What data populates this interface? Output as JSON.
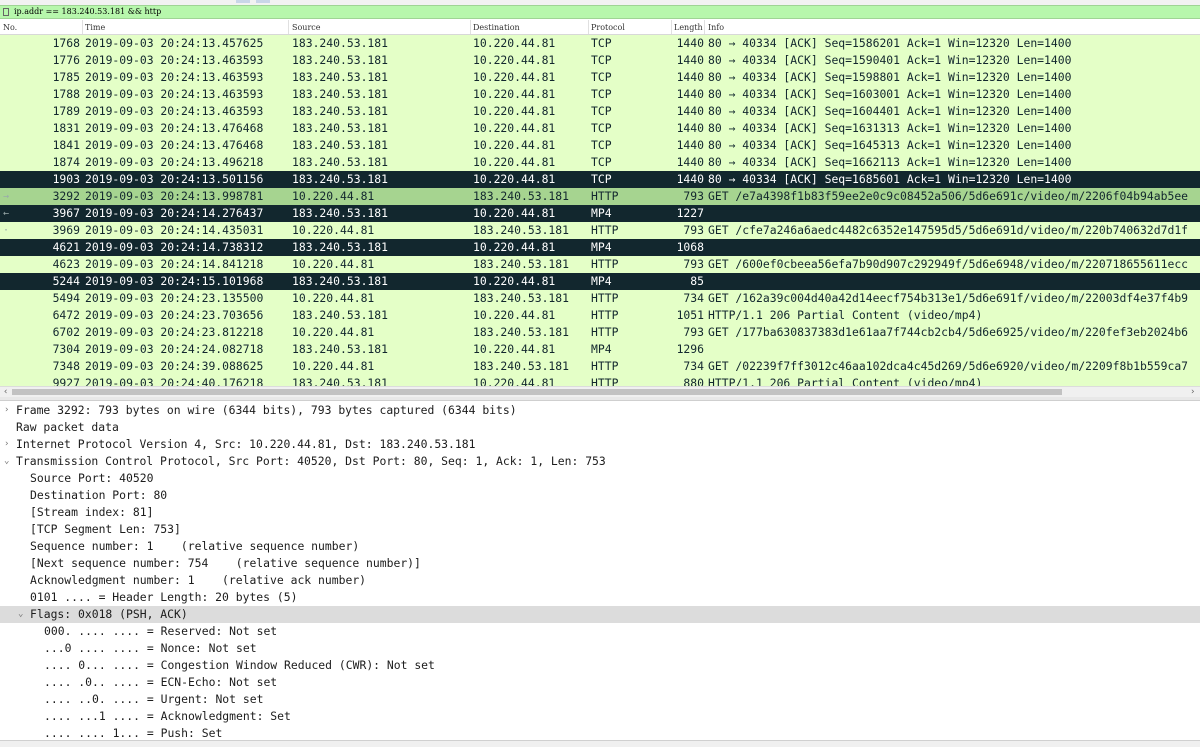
{
  "filter": {
    "text": "ip.addr == 183.240.53.181 && http"
  },
  "columns": {
    "no": "No.",
    "time": "Time",
    "source": "Source",
    "destination": "Destination",
    "protocol": "Protocol",
    "length": "Length",
    "info": "Info"
  },
  "packets": [
    {
      "no": "1768",
      "time": "2019-09-03 20:24:13.457625",
      "src": "183.240.53.181",
      "dst": "10.220.44.81",
      "proto": "TCP",
      "len": "1440",
      "info": "80 → 40334 [ACK] Seq=1586201 Ack=1 Win=12320 Len=1400",
      "style": "green",
      "mark": ""
    },
    {
      "no": "1776",
      "time": "2019-09-03 20:24:13.463593",
      "src": "183.240.53.181",
      "dst": "10.220.44.81",
      "proto": "TCP",
      "len": "1440",
      "info": "80 → 40334 [ACK] Seq=1590401 Ack=1 Win=12320 Len=1400",
      "style": "green",
      "mark": ""
    },
    {
      "no": "1785",
      "time": "2019-09-03 20:24:13.463593",
      "src": "183.240.53.181",
      "dst": "10.220.44.81",
      "proto": "TCP",
      "len": "1440",
      "info": "80 → 40334 [ACK] Seq=1598801 Ack=1 Win=12320 Len=1400",
      "style": "green",
      "mark": ""
    },
    {
      "no": "1788",
      "time": "2019-09-03 20:24:13.463593",
      "src": "183.240.53.181",
      "dst": "10.220.44.81",
      "proto": "TCP",
      "len": "1440",
      "info": "80 → 40334 [ACK] Seq=1603001 Ack=1 Win=12320 Len=1400",
      "style": "green",
      "mark": ""
    },
    {
      "no": "1789",
      "time": "2019-09-03 20:24:13.463593",
      "src": "183.240.53.181",
      "dst": "10.220.44.81",
      "proto": "TCP",
      "len": "1440",
      "info": "80 → 40334 [ACK] Seq=1604401 Ack=1 Win=12320 Len=1400",
      "style": "green",
      "mark": ""
    },
    {
      "no": "1831",
      "time": "2019-09-03 20:24:13.476468",
      "src": "183.240.53.181",
      "dst": "10.220.44.81",
      "proto": "TCP",
      "len": "1440",
      "info": "80 → 40334 [ACK] Seq=1631313 Ack=1 Win=12320 Len=1400",
      "style": "green",
      "mark": ""
    },
    {
      "no": "1841",
      "time": "2019-09-03 20:24:13.476468",
      "src": "183.240.53.181",
      "dst": "10.220.44.81",
      "proto": "TCP",
      "len": "1440",
      "info": "80 → 40334 [ACK] Seq=1645313 Ack=1 Win=12320 Len=1400",
      "style": "green",
      "mark": ""
    },
    {
      "no": "1874",
      "time": "2019-09-03 20:24:13.496218",
      "src": "183.240.53.181",
      "dst": "10.220.44.81",
      "proto": "TCP",
      "len": "1440",
      "info": "80 → 40334 [ACK] Seq=1662113 Ack=1 Win=12320 Len=1400",
      "style": "green",
      "mark": ""
    },
    {
      "no": "1903",
      "time": "2019-09-03 20:24:13.501156",
      "src": "183.240.53.181",
      "dst": "10.220.44.81",
      "proto": "TCP",
      "len": "1440",
      "info": "80 → 40334 [ACK] Seq=1685601 Ack=1 Win=12320 Len=1400",
      "style": "dark",
      "mark": ""
    },
    {
      "no": "3292",
      "time": "2019-09-03 20:24:13.998781",
      "src": "10.220.44.81",
      "dst": "183.240.53.181",
      "proto": "HTTP",
      "len": "793",
      "info": "GET /e7a4398f1b83f59ee2e0c9c08452a506/5d6e691c/video/m/2206f04b94ab5ee",
      "style": "sel",
      "mark": "→"
    },
    {
      "no": "3967",
      "time": "2019-09-03 20:24:14.276437",
      "src": "183.240.53.181",
      "dst": "10.220.44.81",
      "proto": "MP4",
      "len": "1227",
      "info": "",
      "style": "dark",
      "mark": "←"
    },
    {
      "no": "3969",
      "time": "2019-09-03 20:24:14.435031",
      "src": "10.220.44.81",
      "dst": "183.240.53.181",
      "proto": "HTTP",
      "len": "793",
      "info": "GET /cfe7a246a6aedc4482c6352e147595d5/5d6e691d/video/m/220b740632d7d1f",
      "style": "green",
      "mark": "·"
    },
    {
      "no": "4621",
      "time": "2019-09-03 20:24:14.738312",
      "src": "183.240.53.181",
      "dst": "10.220.44.81",
      "proto": "MP4",
      "len": "1068",
      "info": "",
      "style": "dark",
      "mark": ""
    },
    {
      "no": "4623",
      "time": "2019-09-03 20:24:14.841218",
      "src": "10.220.44.81",
      "dst": "183.240.53.181",
      "proto": "HTTP",
      "len": "793",
      "info": "GET /600ef0cbeea56efa7b90d907c292949f/5d6e6948/video/m/220718655611ecc",
      "style": "green",
      "mark": ""
    },
    {
      "no": "5244",
      "time": "2019-09-03 20:24:15.101968",
      "src": "183.240.53.181",
      "dst": "10.220.44.81",
      "proto": "MP4",
      "len": "85",
      "info": "",
      "style": "dark",
      "mark": ""
    },
    {
      "no": "5494",
      "time": "2019-09-03 20:24:23.135500",
      "src": "10.220.44.81",
      "dst": "183.240.53.181",
      "proto": "HTTP",
      "len": "734",
      "info": "GET /162a39c004d40a42d14eecf754b313e1/5d6e691f/video/m/22003df4e37f4b9",
      "style": "green",
      "mark": ""
    },
    {
      "no": "6472",
      "time": "2019-09-03 20:24:23.703656",
      "src": "183.240.53.181",
      "dst": "10.220.44.81",
      "proto": "HTTP",
      "len": "1051",
      "info": "HTTP/1.1 206 Partial Content  (video/mp4)",
      "style": "green",
      "mark": ""
    },
    {
      "no": "6702",
      "time": "2019-09-03 20:24:23.812218",
      "src": "10.220.44.81",
      "dst": "183.240.53.181",
      "proto": "HTTP",
      "len": "793",
      "info": "GET /177ba630837383d1e61aa7f744cb2cb4/5d6e6925/video/m/220fef3eb2024b6",
      "style": "green",
      "mark": ""
    },
    {
      "no": "7304",
      "time": "2019-09-03 20:24:24.082718",
      "src": "183.240.53.181",
      "dst": "10.220.44.81",
      "proto": "MP4",
      "len": "1296",
      "info": "",
      "style": "green",
      "mark": ""
    },
    {
      "no": "7348",
      "time": "2019-09-03 20:24:39.088625",
      "src": "10.220.44.81",
      "dst": "183.240.53.181",
      "proto": "HTTP",
      "len": "734",
      "info": "GET /02239f7ff3012c46aa102dca4c45d269/5d6e6920/video/m/2209f8b1b559ca7",
      "style": "green",
      "mark": ""
    },
    {
      "no": "9927",
      "time": "2019-09-03 20:24:40.176218",
      "src": "183.240.53.181",
      "dst": "10.220.44.81",
      "proto": "HTTP",
      "len": "880",
      "info": "HTTP/1.1 206 Partial Content  (video/mp4)",
      "style": "green",
      "mark": ""
    }
  ],
  "details": [
    {
      "indent": 0,
      "arrow": "›",
      "text": "Frame 3292: 793 bytes on wire (6344 bits), 793 bytes captured (6344 bits)",
      "hl": false
    },
    {
      "indent": 0,
      "arrow": "",
      "text": "Raw packet data",
      "hl": false
    },
    {
      "indent": 0,
      "arrow": "›",
      "text": "Internet Protocol Version 4, Src: 10.220.44.81, Dst: 183.240.53.181",
      "hl": false
    },
    {
      "indent": 0,
      "arrow": "⌄",
      "text": "Transmission Control Protocol, Src Port: 40520, Dst Port: 80, Seq: 1, Ack: 1, Len: 753",
      "hl": false
    },
    {
      "indent": 1,
      "arrow": "",
      "text": "Source Port: 40520",
      "hl": false
    },
    {
      "indent": 1,
      "arrow": "",
      "text": "Destination Port: 80",
      "hl": false
    },
    {
      "indent": 1,
      "arrow": "",
      "text": "[Stream index: 81]",
      "hl": false
    },
    {
      "indent": 1,
      "arrow": "",
      "text": "[TCP Segment Len: 753]",
      "hl": false
    },
    {
      "indent": 1,
      "arrow": "",
      "text": "Sequence number: 1    (relative sequence number)",
      "hl": false
    },
    {
      "indent": 1,
      "arrow": "",
      "text": "[Next sequence number: 754    (relative sequence number)]",
      "hl": false
    },
    {
      "indent": 1,
      "arrow": "",
      "text": "Acknowledgment number: 1    (relative ack number)",
      "hl": false
    },
    {
      "indent": 1,
      "arrow": "",
      "text": "0101 .... = Header Length: 20 bytes (5)",
      "hl": false
    },
    {
      "indent": 1,
      "arrow": "⌄",
      "text": "Flags: 0x018 (PSH, ACK)",
      "hl": true
    },
    {
      "indent": 2,
      "arrow": "",
      "text": "000. .... .... = Reserved: Not set",
      "hl": false
    },
    {
      "indent": 2,
      "arrow": "",
      "text": "...0 .... .... = Nonce: Not set",
      "hl": false
    },
    {
      "indent": 2,
      "arrow": "",
      "text": ".... 0... .... = Congestion Window Reduced (CWR): Not set",
      "hl": false
    },
    {
      "indent": 2,
      "arrow": "",
      "text": ".... .0.. .... = ECN-Echo: Not set",
      "hl": false
    },
    {
      "indent": 2,
      "arrow": "",
      "text": ".... ..0. .... = Urgent: Not set",
      "hl": false
    },
    {
      "indent": 2,
      "arrow": "",
      "text": ".... ...1 .... = Acknowledgment: Set",
      "hl": false
    },
    {
      "indent": 2,
      "arrow": "",
      "text": ".... .... 1... = Push: Set",
      "hl": false
    }
  ],
  "colors": {
    "filter_bg": "#b7f7ac",
    "http_row": "#e4ffc7",
    "dark_row": "#12272e",
    "selected_row": "#a6d490"
  }
}
